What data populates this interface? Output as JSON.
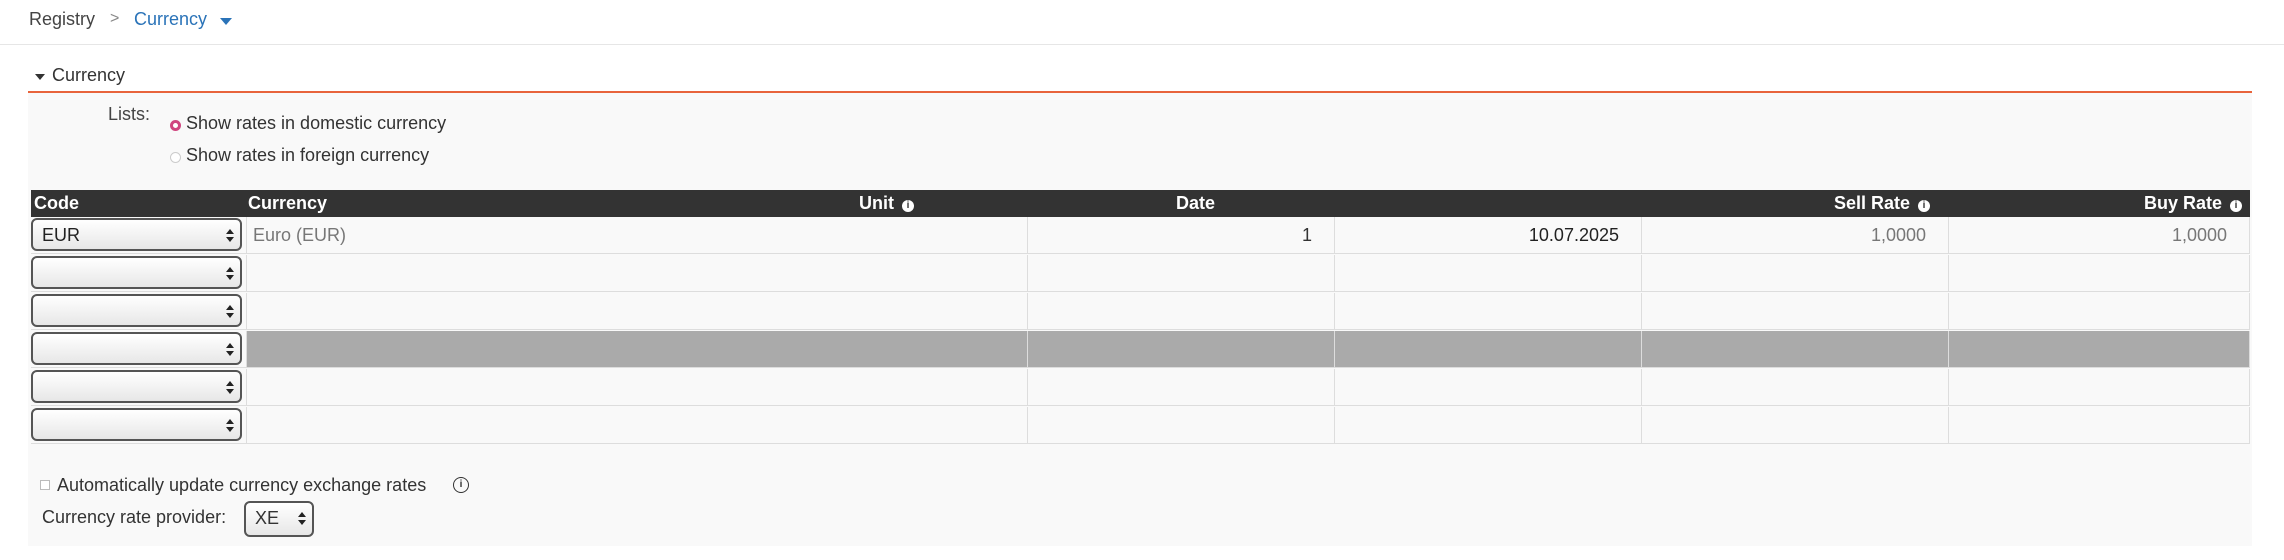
{
  "breadcrumb": {
    "root": "Registry",
    "separator": ">",
    "current": "Currency"
  },
  "section": {
    "title": "Currency"
  },
  "lists": {
    "label": "Lists:",
    "options": [
      {
        "label": "Show rates in domestic currency",
        "checked": true
      },
      {
        "label": "Show rates in foreign currency",
        "checked": false
      }
    ]
  },
  "table": {
    "columns": [
      "Code",
      "Currency",
      "Unit",
      "Date",
      "Sell Rate",
      "Buy Rate"
    ],
    "info_icon": "i",
    "rows": [
      {
        "code": "EUR",
        "currency": "Euro (EUR)",
        "unit": "1",
        "date": "10.07.2025",
        "sell": "1,0000",
        "buy": "1,0000",
        "selected": false
      },
      {
        "code": "",
        "currency": "",
        "unit": "",
        "date": "",
        "sell": "",
        "buy": "",
        "selected": false
      },
      {
        "code": "",
        "currency": "",
        "unit": "",
        "date": "",
        "sell": "",
        "buy": "",
        "selected": false
      },
      {
        "code": "",
        "currency": "",
        "unit": "",
        "date": "",
        "sell": "",
        "buy": "",
        "selected": true
      },
      {
        "code": "",
        "currency": "",
        "unit": "",
        "date": "",
        "sell": "",
        "buy": "",
        "selected": false
      },
      {
        "code": "",
        "currency": "",
        "unit": "",
        "date": "",
        "sell": "",
        "buy": "",
        "selected": false
      }
    ]
  },
  "auto_update": {
    "label": "Automatically update currency exchange rates",
    "checked": false,
    "info_icon": "i"
  },
  "provider": {
    "label": "Currency rate provider:",
    "value": "XE"
  },
  "colors": {
    "accent": "#2a73b8",
    "section_border": "#e8643c",
    "radio": "#d0457f",
    "header_bg": "#333333",
    "selected_row": "#aaaaaa"
  }
}
